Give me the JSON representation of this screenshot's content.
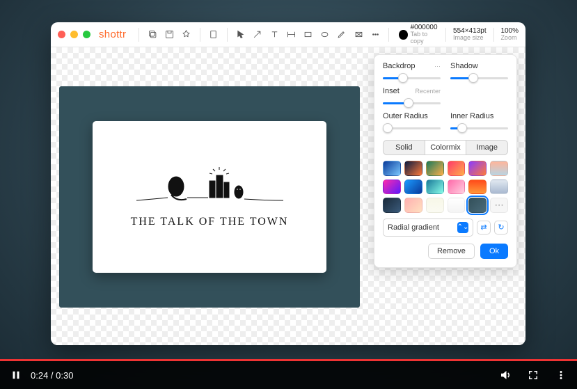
{
  "video": {
    "current_time": "0:24",
    "duration": "0:30"
  },
  "app": {
    "logo": "shottr",
    "color_hex": "#000000",
    "color_sub": "Tab to copy",
    "image_size": "554×413pt",
    "image_size_sub": "Image size",
    "zoom": "100%",
    "zoom_sub": "Zoom"
  },
  "artboard": {
    "caption": "THE TALK OF THE TOWN"
  },
  "panel": {
    "backdrop_label": "Backdrop",
    "backdrop_more": "···",
    "shadow_label": "Shadow",
    "inset_label": "Inset",
    "inset_hint": "Recenter",
    "outer_radius_label": "Outer Radius",
    "inner_radius_label": "Inner Radius",
    "seg": {
      "solid": "Solid",
      "colormix": "Colormix",
      "image": "Image"
    },
    "gradient_select": "Radial gradient",
    "remove": "Remove",
    "ok": "Ok",
    "sliders": {
      "backdrop": 35,
      "shadow": 40,
      "inset": 45,
      "outer": 8,
      "inner": 20
    },
    "swatch_colors": [
      "linear-gradient(135deg,#0a3a9a,#7bc8ff)",
      "linear-gradient(135deg,#0a1a40,#ff7a3a)",
      "linear-gradient(135deg,#1a7a5a,#ffb04a)",
      "linear-gradient(135deg,#ff3a6a,#ffb04a)",
      "linear-gradient(135deg,#8a3aff,#ff7a3a)",
      "linear-gradient(180deg,#ffb59a,#b8d4e3)",
      "linear-gradient(135deg,#ff2aaa,#5a1aff)",
      "linear-gradient(135deg,#1a9aff,#0a3a9a)",
      "linear-gradient(135deg,#1a7a9a,#8affea)",
      "linear-gradient(135deg,#ff6aaa,#ffd0e0)",
      "linear-gradient(180deg,#ff4a1a,#ff9a3a)",
      "linear-gradient(180deg,#e0e8f0,#a8b8d0)",
      "linear-gradient(135deg,#1a2a3a,#3a5a7a)",
      "linear-gradient(135deg,#ffb0b0,#ffe0c0)",
      "linear-gradient(180deg,#f8f8e8,#fafaf2)",
      "linear-gradient(180deg,#fff,#f4f4f4)",
      "linear-gradient(135deg,#33505a,#4a6b7a)"
    ],
    "selected_swatch": 16
  }
}
